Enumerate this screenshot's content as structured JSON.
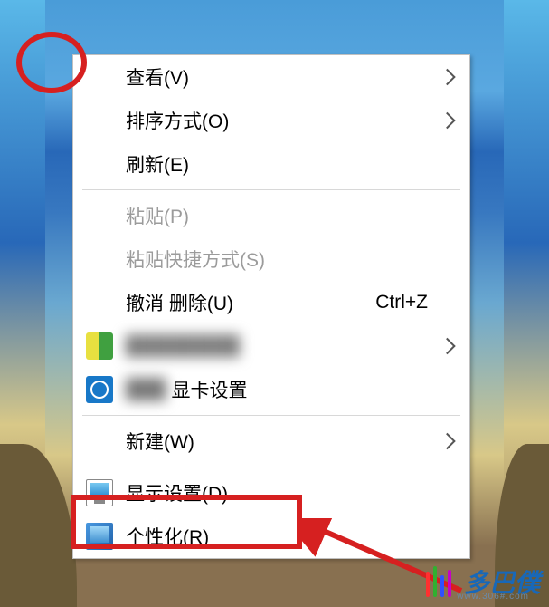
{
  "menu": {
    "view": "查看(V)",
    "sort": "排序方式(O)",
    "refresh": "刷新(E)",
    "paste": "粘贴(P)",
    "paste_shortcut": "粘贴快捷方式(S)",
    "undo_delete": "撤消 删除(U)",
    "undo_shortcut": "Ctrl+Z",
    "gfx_suffix": "显卡设置",
    "new": "新建(W)",
    "display_settings": "显示设置(D)",
    "personalize": "个性化(R)"
  },
  "watermark": {
    "text": "多巴僕",
    "url": "www.306#.com"
  }
}
